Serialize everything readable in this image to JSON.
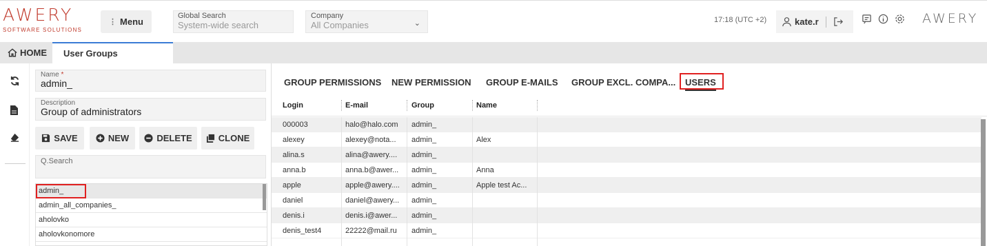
{
  "brand": {
    "logo_text": "AWERY",
    "tagline": "SOFTWARE SOLUTIONS",
    "logo_right": "AWERY"
  },
  "header": {
    "menu_label": "Menu",
    "global_search_label": "Global Search",
    "global_search_placeholder": "System-wide search",
    "company_label": "Company",
    "company_value": "All Companies",
    "time": "17:18 (UTC +2)",
    "username": "kate.r"
  },
  "tabs": {
    "home": "HOME",
    "current": "User Groups"
  },
  "form": {
    "name_label": "Name",
    "name_required": "*",
    "name_value": "admin_",
    "description_label": "Description",
    "description_value": "Group of administrators",
    "save": "SAVE",
    "new": "NEW",
    "delete": "DELETE",
    "clone": "CLONE",
    "qsearch_label": "Q.Search"
  },
  "group_list": [
    "admin_",
    "admin_all_companies_",
    "aholovko",
    "aholovkonomore"
  ],
  "right_tabs": [
    "GROUP PERMISSIONS",
    "NEW PERMISSION",
    "GROUP E-MAILS",
    "GROUP EXCL. COMPA...",
    "USERS"
  ],
  "table": {
    "columns": [
      "Login",
      "E-mail",
      "Group",
      "Name"
    ],
    "rows": [
      [
        "000003",
        "halo@halo.com",
        "admin_",
        ""
      ],
      [
        "alexey",
        "alexey@nota...",
        "admin_",
        "Alex"
      ],
      [
        "alina.s",
        "alina@awery....",
        "admin_",
        ""
      ],
      [
        "anna.b",
        "anna.b@awer...",
        "admin_",
        "Anna"
      ],
      [
        "apple",
        "apple@awery....",
        "admin_",
        "Apple test Ac..."
      ],
      [
        "daniel",
        "daniel@awery...",
        "admin_",
        ""
      ],
      [
        "denis.i",
        "denis.i@awer...",
        "admin_",
        ""
      ],
      [
        "denis_test4",
        "22222@mail.ru",
        "admin_",
        ""
      ]
    ]
  },
  "colors": {
    "brand_red": "#c0392b",
    "highlight": "#e02020",
    "tab_accent": "#3a7bd5"
  }
}
